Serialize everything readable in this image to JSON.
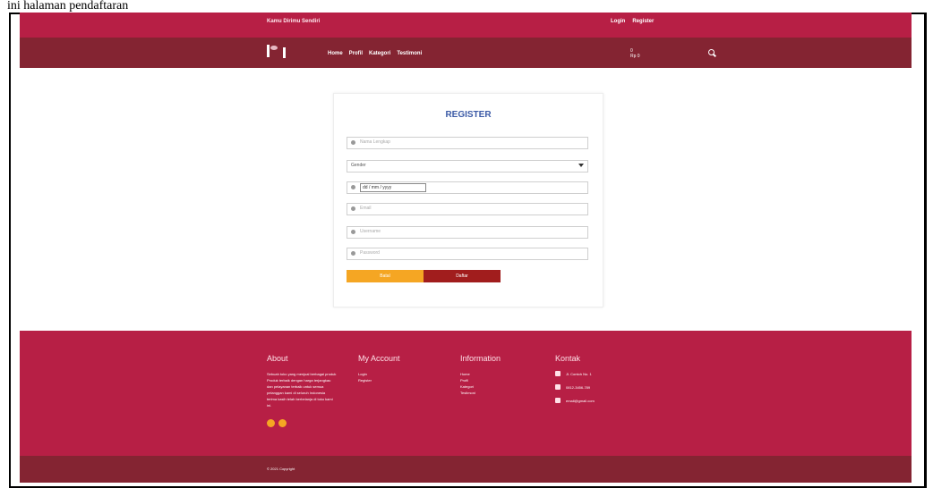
{
  "header_text": "ini halaman pendaftaran",
  "topbar": {
    "brand": "Kamu Dirimu Sendiri",
    "login": "Login",
    "register": "Register"
  },
  "nav": {
    "items": [
      "Home",
      "Profil",
      "Kategori",
      "Testimoni"
    ],
    "cart_line1": "0",
    "cart_line2": "Rp 0",
    "search_icon": "search-icon"
  },
  "form": {
    "title": "REGISTER",
    "name_placeholder": "Nama Lengkap",
    "gender_selected": "Gender",
    "date_value": "dd / mm / yyyy",
    "email_placeholder": "Email",
    "username_placeholder": "Username",
    "password_placeholder": "Password",
    "cancel_label": "Batal",
    "submit_label": "Daftar"
  },
  "footer": {
    "about_title": "About",
    "about_lines": [
      "Sebuah toko yang menjual berbagai produk",
      "Produk terbaik dengan harga terjangkau",
      "dan pelayanan terbaik untuk semua",
      "pelanggan kami di seluruh Indonesia",
      "terima kasih telah berbelanja di toko kami",
      "ini."
    ],
    "account_title": "My Account",
    "account_items": [
      "Login",
      "Register"
    ],
    "info_title": "Information",
    "info_items": [
      "Home",
      "Profil",
      "Kategori",
      "Testimoni"
    ],
    "contact_title": "Kontak",
    "contact_address": "Jl. Contoh No. 1",
    "contact_phone": "0812-3456-789",
    "contact_email": "email@gmail.com"
  },
  "copyright": "© 2021 Copyright"
}
